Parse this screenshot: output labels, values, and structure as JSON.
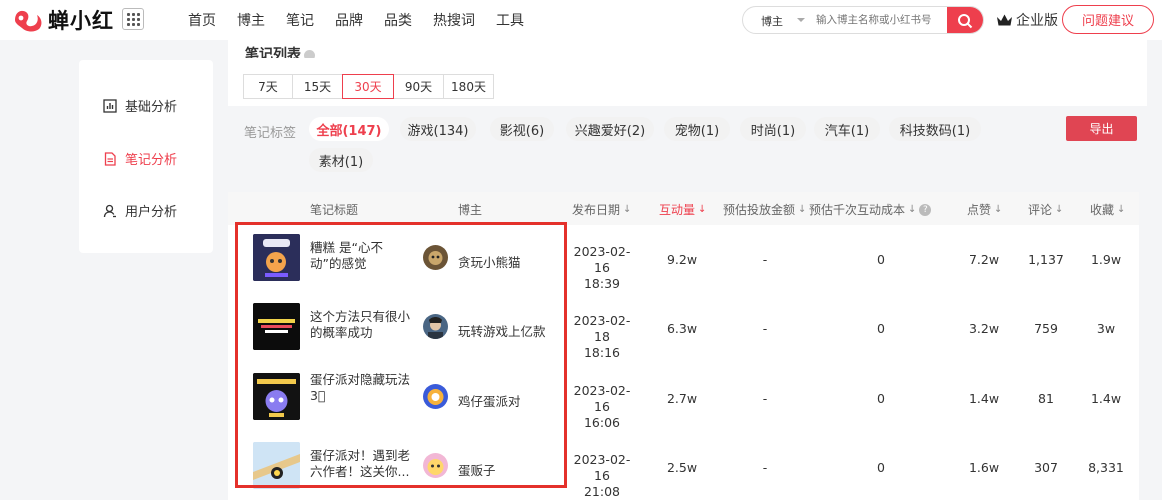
{
  "brand": {
    "name": "蝉小红",
    "color": "#ee3f4d"
  },
  "nav": [
    "首页",
    "博主",
    "笔记",
    "品牌",
    "品类",
    "热搜词",
    "工具"
  ],
  "search": {
    "scope": "博主",
    "placeholder": "输入博主名称或小红书号",
    "icon": "search-icon"
  },
  "enterprise": {
    "label": "企业版",
    "icon": "crown-icon"
  },
  "help_button": "问题建议",
  "sidebar": {
    "items": [
      {
        "label": "基础分析",
        "icon": "bar-chart-icon",
        "active": false
      },
      {
        "label": "笔记分析",
        "icon": "document-icon",
        "active": true
      },
      {
        "label": "用户分析",
        "icon": "user-icon",
        "active": false
      }
    ]
  },
  "notes_card": {
    "title": "笔记列表",
    "days": [
      {
        "label": "7天",
        "active": false
      },
      {
        "label": "15天",
        "active": false
      },
      {
        "label": "30天",
        "active": true
      },
      {
        "label": "90天",
        "active": false
      },
      {
        "label": "180天",
        "active": false
      }
    ]
  },
  "tags": {
    "label": "笔记标签",
    "items": [
      {
        "label": "全部(147)",
        "active": true
      },
      {
        "label": "游戏(134)",
        "active": false
      },
      {
        "label": "影视(6)",
        "active": false
      },
      {
        "label": "兴趣爱好(2)",
        "active": false
      },
      {
        "label": "宠物(1)",
        "active": false
      },
      {
        "label": "时尚(1)",
        "active": false
      },
      {
        "label": "汽车(1)",
        "active": false
      },
      {
        "label": "科技数码(1)",
        "active": false
      },
      {
        "label": "素材(1)",
        "active": false
      }
    ]
  },
  "export_button": "导出",
  "table": {
    "headers": {
      "title": "笔记标题",
      "blogger": "博主",
      "date": "发布日期",
      "interactions": "互动量",
      "est_amount": "预估投放金额",
      "est_cost": "预估千次互动成本",
      "likes": "点赞",
      "comments": "评论",
      "favorites": "收藏"
    },
    "rows": [
      {
        "title": "糟糕 是“心不动”的感觉",
        "blogger": "贪玩小熊猫",
        "date": "2023-02-16",
        "time": "18:39",
        "interactions": "9.2w",
        "est_amount": "-",
        "est_cost": "0",
        "likes": "7.2w",
        "comments": "1,137",
        "favorites": "1.9w"
      },
      {
        "title": "这个方法只有很小的概率成功",
        "blogger": "玩转游戏上亿款",
        "date": "2023-02-18",
        "time": "18:16",
        "interactions": "6.3w",
        "est_amount": "-",
        "est_cost": "0",
        "likes": "3.2w",
        "comments": "759",
        "favorites": "3w"
      },
      {
        "title": "蛋仔派对隐藏玩法3⃣",
        "blogger": "鸡仔蛋派对",
        "date": "2023-02-16",
        "time": "16:06",
        "interactions": "2.7w",
        "est_amount": "-",
        "est_cost": "0",
        "likes": "1.4w",
        "comments": "81",
        "favorites": "1.4w"
      },
      {
        "title": "蛋仔派对！遇到老六作者！这关你...",
        "blogger": "蛋贩子",
        "date": "2023-02-16",
        "time": "21:08",
        "interactions": "2.5w",
        "est_amount": "-",
        "est_cost": "0",
        "likes": "1.6w",
        "comments": "307",
        "favorites": "8,331"
      }
    ]
  }
}
